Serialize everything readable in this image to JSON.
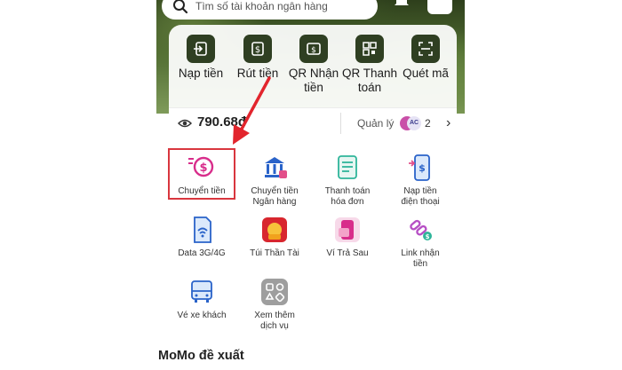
{
  "search": {
    "placeholder": "Tìm số tài khoản ngân hàng"
  },
  "quick_actions": [
    {
      "label_lines": [
        "Nạp tiền"
      ],
      "icon": "deposit-icon"
    },
    {
      "label_lines": [
        "Rút tiền"
      ],
      "icon": "withdraw-icon"
    },
    {
      "label_lines": [
        "QR Nhận",
        "tiền"
      ],
      "icon": "qr-receive-icon"
    },
    {
      "label_lines": [
        "QR Thanh",
        "toán"
      ],
      "icon": "qr-pay-icon"
    },
    {
      "label_lines": [
        "Quét mã"
      ],
      "icon": "scan-icon"
    }
  ],
  "balance": {
    "amount": "790.68đ",
    "manage_label": "Quản lý",
    "account_count": "2",
    "avatar_text": "AC"
  },
  "services": [
    {
      "label_lines": [
        "Chuyển tiền"
      ],
      "icon": "transfer-money-icon",
      "highlighted": true
    },
    {
      "label_lines": [
        "Chuyển tiền",
        "Ngân hàng"
      ],
      "icon": "bank-icon"
    },
    {
      "label_lines": [
        "Thanh toán",
        "hóa đơn"
      ],
      "icon": "bill-icon"
    },
    {
      "label_lines": [
        "Nạp tiền",
        "điện thoại"
      ],
      "icon": "phone-topup-icon"
    },
    {
      "label_lines": [
        "Data 3G/4G"
      ],
      "icon": "data-sim-icon"
    },
    {
      "label_lines": [
        "Túi Thần Tài"
      ],
      "icon": "god-of-wealth-bag-icon"
    },
    {
      "label_lines": [
        "Ví Trả Sau"
      ],
      "icon": "paylater-wallet-icon"
    },
    {
      "label_lines": [
        "Link nhận",
        "tiền"
      ],
      "icon": "link-receive-icon"
    },
    {
      "label_lines": [
        "Vé xe khách"
      ],
      "icon": "bus-ticket-icon"
    },
    {
      "label_lines": [
        "Xem thêm",
        "dịch vụ"
      ],
      "icon": "more-services-icon"
    }
  ],
  "section_title": "MoMo đề xuất",
  "colors": {
    "accent_pink": "#d82d8b",
    "highlight_red": "#d9363e",
    "dark_green": "#2f3f22"
  }
}
